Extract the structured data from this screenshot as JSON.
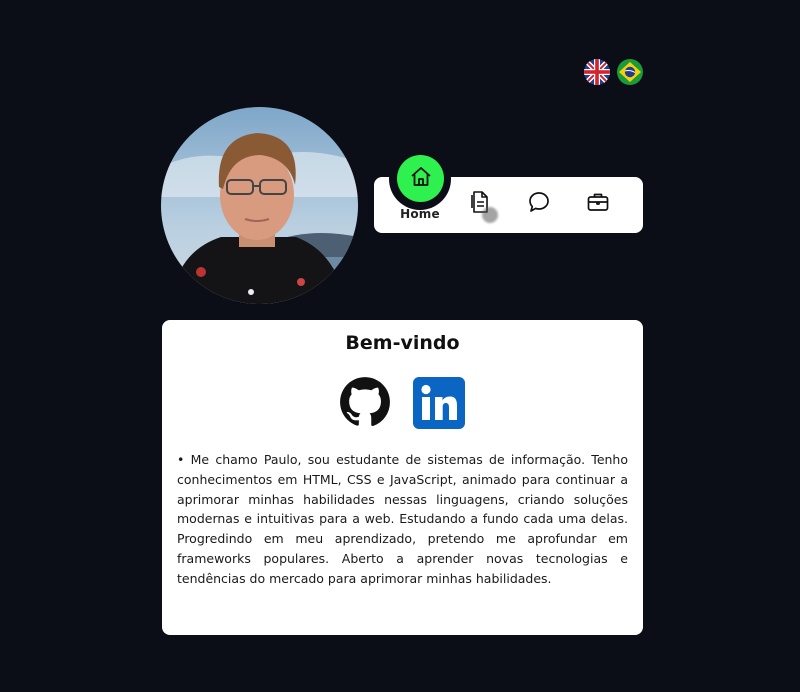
{
  "languages": [
    {
      "name": "uk-flag-icon",
      "label": "English"
    },
    {
      "name": "brazil-flag-icon",
      "label": "Português"
    }
  ],
  "profile": {
    "photo_alt": "Paulo"
  },
  "nav": {
    "active_label": "Home",
    "items": [
      {
        "icon": "home-icon",
        "label": "Home"
      },
      {
        "icon": "document-icon"
      },
      {
        "icon": "chat-icon"
      },
      {
        "icon": "briefcase-icon"
      }
    ],
    "active_color": "#2ef04f"
  },
  "card": {
    "title": "Bem-vindo",
    "links": [
      {
        "icon": "github-icon"
      },
      {
        "icon": "linkedin-icon",
        "color": "#0a66c2"
      }
    ],
    "body": "• Me chamo Paulo, sou estudante de sistemas de informação. Tenho conhecimentos em HTML, CSS e JavaScript, animado para continuar a aprimorar minhas habilidades nessas linguagens, criando soluções modernas e intuitivas para a web. Estudando a fundo cada uma delas. Progredindo em meu aprendizado, pretendo me aprofundar em frameworks populares. Aberto a aprender novas tecnologias e tendências do mercado para aprimorar minhas habilidades."
  },
  "colors": {
    "background": "#0b0e16",
    "surface": "#ffffff"
  }
}
